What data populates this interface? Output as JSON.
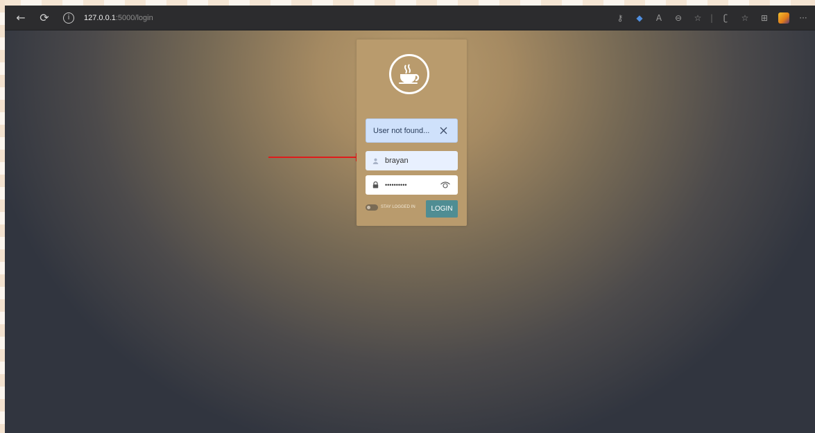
{
  "browser": {
    "url_host": "127.0.0.1",
    "url_path": ":5000/login",
    "toolbar_icons": [
      "key-icon",
      "tag-icon",
      "read-aloud-icon",
      "zoom-icon",
      "favorite-add-icon",
      "extension-icon",
      "favorites-icon",
      "collections-icon",
      "profile-icon",
      "more-icon"
    ]
  },
  "login": {
    "alert_text": "User not found...",
    "username_value": "brayan",
    "password_value": "••••••••••",
    "stay_logged_label": "STAY LOGGED IN",
    "login_label": "LOGIN"
  },
  "colors": {
    "card": "#b99b6d",
    "alert_bg": "#cfe1fb",
    "login_button": "#4f8d93",
    "arrow": "#e01b1b"
  }
}
